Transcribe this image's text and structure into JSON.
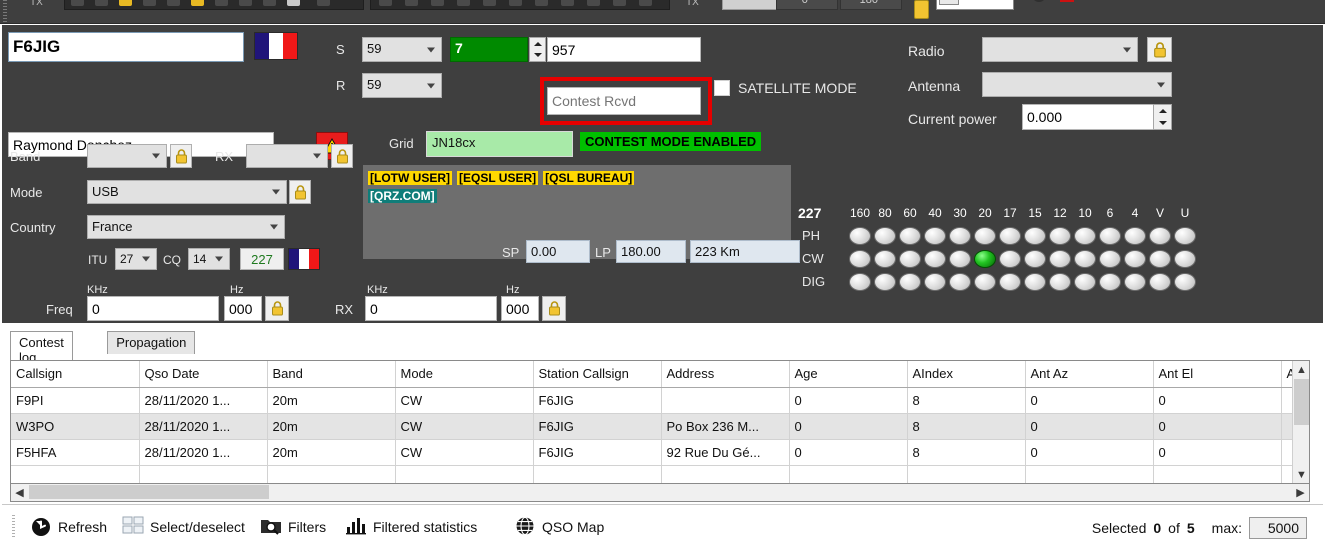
{
  "toolbar_strip": {
    "deg_left": "0°",
    "deg_right": "180°",
    "spin_value": "0"
  },
  "qso": {
    "callsign_value": "F6JIG",
    "callsign_flag": "flag-france",
    "operator_name": "Raymond Donchez",
    "warning_icon": "warning-icon",
    "rst_sent_label": "S",
    "rst_sent_value": "59",
    "rst_rcvd_label": "R",
    "rst_rcvd_value": "59",
    "contest_serial_value": "7",
    "contest_sent_value": "957",
    "contest_rcvd_placeholder": "Contest Rcvd",
    "satellite_mode_label": "SATELLITE MODE",
    "satellite_mode_checked": false,
    "grid_label": "Grid",
    "grid_value": "JN18cx",
    "contest_mode_badge": "CONTEST MODE ENABLED",
    "band_label": "Band",
    "band_value": "",
    "rx_band_label": "RX",
    "rx_band_value": "",
    "mode_label": "Mode",
    "mode_value": "USB",
    "country_label": "Country",
    "country_value": "France",
    "itu_label": "ITU",
    "itu_value": "27",
    "cq_label": "CQ",
    "cq_value": "14",
    "dxcc_value": "227",
    "freq_label": "Freq",
    "freq_khz_label": "KHz",
    "freq_khz_value": "0",
    "freq_hz_label": "Hz",
    "freq_hz_value": "000",
    "rx_label": "RX",
    "rx_khz_label": "KHz",
    "rx_khz_value": "0",
    "rx_hz_label": "Hz",
    "rx_hz_value": "000",
    "sp_label": "SP",
    "sp_value": "0.00",
    "lp_label": "LP",
    "lp_value": "180.00",
    "distance_value": "223 Km"
  },
  "tags": [
    {
      "text": "[LOTW USER]",
      "style": "yellow"
    },
    {
      "text": "[EQSL USER]",
      "style": "yellow"
    },
    {
      "text": "[QSL BUREAU]",
      "style": "yellow"
    },
    {
      "text": "[QRZ.COM]",
      "style": "teal"
    }
  ],
  "rig": {
    "radio_label": "Radio",
    "radio_value": "",
    "antenna_label": "Antenna",
    "antenna_value": "",
    "power_label": "Current power",
    "power_value": "0.000"
  },
  "band_matrix": {
    "count": "227",
    "columns": [
      "160",
      "80",
      "60",
      "40",
      "30",
      "20",
      "17",
      "15",
      "12",
      "10",
      "6",
      "4",
      "V",
      "U"
    ],
    "rows": [
      {
        "label": "PH",
        "on": []
      },
      {
        "label": "CW",
        "on": [
          5
        ]
      },
      {
        "label": "DIG",
        "on": []
      }
    ]
  },
  "tabs": [
    {
      "label": "Contest log",
      "active": true
    },
    {
      "label": "Propagation",
      "active": false
    }
  ],
  "table": {
    "columns": [
      "Callsign",
      "Qso Date",
      "Band",
      "Mode",
      "Station Callsign",
      "Address",
      "Age",
      "AIndex",
      "Ant Az",
      "Ant El",
      "An"
    ],
    "rows": [
      [
        "F9PI",
        "28/11/2020 1...",
        "20m",
        "CW",
        "F6JIG",
        "",
        "0",
        "8",
        "0",
        "0",
        ""
      ],
      [
        "W3PO",
        "28/11/2020 1...",
        "20m",
        "CW",
        "F6JIG",
        "Po Box 236 M...",
        "0",
        "8",
        "0",
        "0",
        ""
      ],
      [
        "F5HFA",
        "28/11/2020 1...",
        "20m",
        "CW",
        "F6JIG",
        "92 Rue Du Gé...",
        "0",
        "8",
        "0",
        "0",
        ""
      ]
    ]
  },
  "bottom": {
    "refresh_label": "Refresh",
    "select_label": "Select/deselect",
    "filters_label": "Filters",
    "stats_label": "Filtered statistics",
    "map_label": "QSO Map",
    "selected_prefix": "Selected",
    "selected_count": "0",
    "of_word": "of",
    "total_count": "5",
    "max_label": "max:",
    "max_value": "5000"
  },
  "colors": {
    "panel_bg": "#3f3f3f",
    "accent_green": "#00c000",
    "highlight_red": "#e60000",
    "tag_yellow": "#ffd800",
    "tag_teal": "#0f7d79",
    "lock_gold": "#f2c431"
  }
}
